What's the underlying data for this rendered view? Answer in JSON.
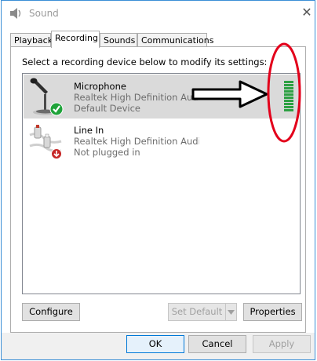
{
  "window": {
    "title": "Sound",
    "close_glyph": "✕"
  },
  "tabs": [
    {
      "label": "Playback"
    },
    {
      "label": "Recording",
      "active": true
    },
    {
      "label": "Sounds"
    },
    {
      "label": "Communications"
    }
  ],
  "panel": {
    "instruction": "Select a recording device below to modify its settings:"
  },
  "devices": [
    {
      "name": "Microphone",
      "description": "Realtek High Definition Audio",
      "status": "Default Device",
      "selected": true,
      "status_icon": "green-check-icon",
      "level_fraction": 1.0
    },
    {
      "name": "Line In",
      "description": "Realtek High Definition Audio",
      "status": "Not plugged in",
      "selected": false,
      "status_icon": "red-down-arrow-icon"
    }
  ],
  "panel_buttons": {
    "configure": "Configure",
    "set_default": "Set Default",
    "properties": "Properties"
  },
  "footer_buttons": {
    "ok": "OK",
    "cancel": "Cancel",
    "apply": "Apply"
  },
  "colors": {
    "meter_green": "#2ea043",
    "annotation_red": "#e3001b",
    "selection_gray": "#dadada",
    "window_border": "#3c8fd6"
  }
}
